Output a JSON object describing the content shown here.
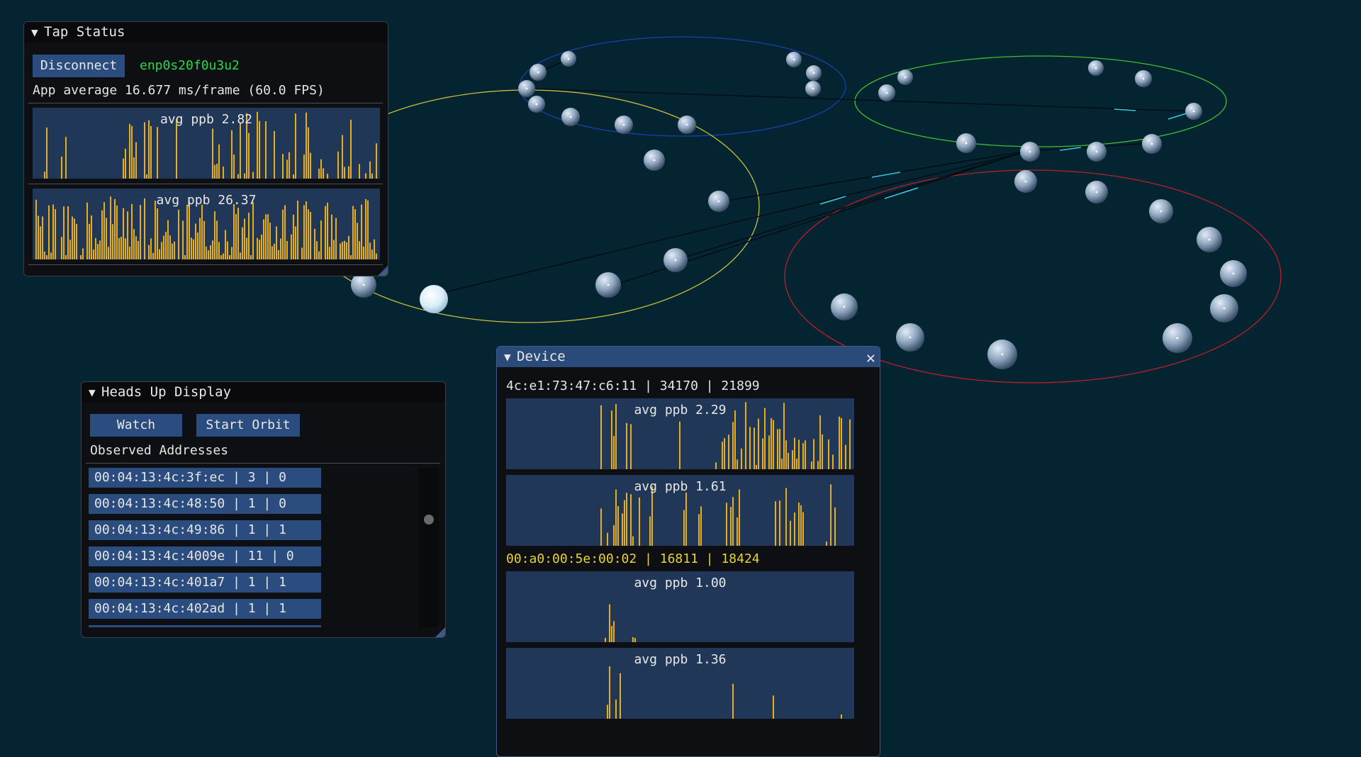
{
  "colors": {
    "background": "#042432",
    "plot_bg": "#203757",
    "bar": "#e8b012",
    "button": "#2a4c7e",
    "iface_green": "#2ad84a",
    "highlight_yellow": "#e8d23a"
  },
  "tap_status": {
    "title": "Tap Status",
    "disconnect_label": "Disconnect",
    "interface": "enp0s20f0u3u2",
    "app_average": "App average 16.677 ms/frame (60.0 FPS)",
    "plot1_label": "avg ppb 2.82",
    "plot2_label": "avg ppb 26.37"
  },
  "hud": {
    "title": "Heads Up Display",
    "watch_label": "Watch",
    "start_orbit_label": "Start Orbit",
    "observed_label": "Observed Addresses",
    "addresses": [
      "00:04:13:4c:3f:ec | 3 | 0",
      "00:04:13:4c:48:50 | 1 | 0",
      "00:04:13:4c:49:86 | 1 | 1",
      "00:04:13:4c:4009e | 11 | 0",
      "00:04:13:4c:401a7 | 1 | 1",
      "00:04:13:4c:402ad | 1 | 1"
    ]
  },
  "device": {
    "title": "Device",
    "close_icon": "close-icon",
    "dev1": {
      "header": "4c:e1:73:47:c6:11 | 34170 | 21899",
      "plot1_label": "avg ppb 2.29",
      "plot2_label": "avg ppb 1.61"
    },
    "dev2": {
      "header": "00:a0:00:5e:00:02 | 16811 | 18424",
      "plot1_label": "avg ppb 1.00",
      "plot2_label": "avg ppb 1.36"
    }
  }
}
